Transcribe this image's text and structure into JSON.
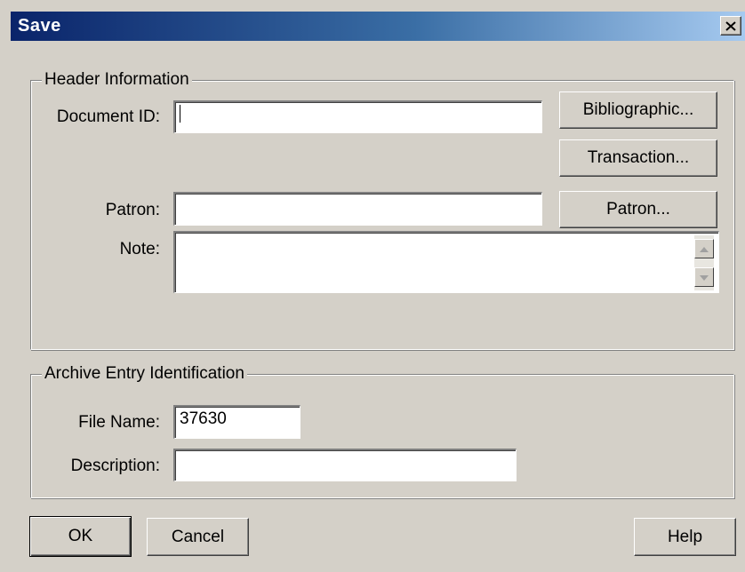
{
  "window": {
    "title": "Save"
  },
  "header_group": {
    "label": "Header Information",
    "document_id_label": "Document ID:",
    "document_id_value": "",
    "patron_label": "Patron:",
    "patron_value": "",
    "note_label": "Note:",
    "note_value": "",
    "bibliographic_button": "Bibliographic...",
    "transaction_button": "Transaction...",
    "patron_button": "Patron..."
  },
  "archive_group": {
    "label": "Archive Entry Identification",
    "file_name_label": "File Name:",
    "file_name_value": "37630",
    "description_label": "Description:",
    "description_value": ""
  },
  "footer": {
    "ok_label": "OK",
    "cancel_label": "Cancel",
    "help_label": "Help"
  },
  "icons": {
    "close": "close-icon",
    "scroll_up": "arrow-up-icon",
    "scroll_down": "arrow-down-icon"
  },
  "colors": {
    "titlebar_start": "#0a246a",
    "titlebar_end": "#a6caf0",
    "face": "#d4d0c8"
  }
}
